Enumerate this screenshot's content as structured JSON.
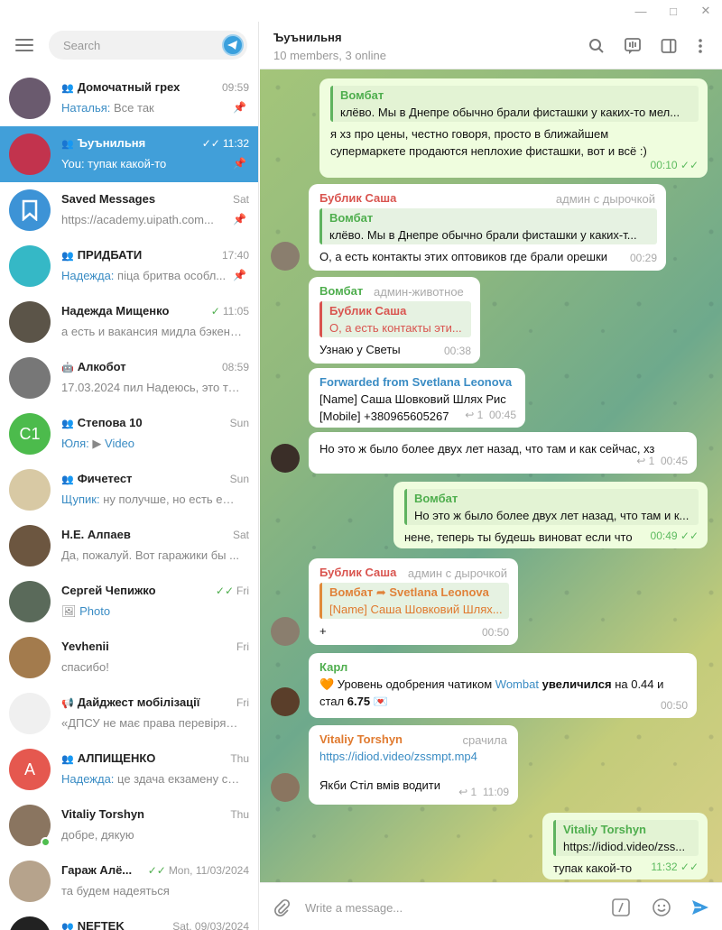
{
  "search": {
    "placeholder": "Search"
  },
  "chats": [
    {
      "name": "Домочатный грех",
      "time": "09:59",
      "sender": "Наталья: ",
      "preview": "Все так",
      "pinned": true,
      "group": true,
      "color": "#6a5a6e"
    },
    {
      "name": "Ъуъниль​ня",
      "time": "11:32",
      "sender": "You: ",
      "preview": "тупак какой-то",
      "pinned": true,
      "group": true,
      "read": true,
      "color": "#c2334d"
    },
    {
      "name": "Saved Messages",
      "time": "Sat",
      "sender": "",
      "preview": "https://academy.uipath.com...",
      "pinned": true,
      "color": "#3d93d6"
    },
    {
      "name": "ПРИДБАТИ",
      "time": "17:40",
      "sender": "Надежда: ",
      "preview": "піца бритва особл...",
      "pinned": true,
      "group": true,
      "color": "#35b8c6"
    },
    {
      "name": "Надежда Мищенко",
      "time": "11:05",
      "sender": "",
      "preview": "а есть и вакансия мидла бэкенд ...",
      "read_single": true,
      "color": "#5b5448"
    },
    {
      "name": "Алкобот",
      "time": "08:59",
      "sender": "",
      "preview": "17.03.2024 пил Надеюсь, это тог...",
      "bot": true,
      "color": "#777"
    },
    {
      "name": "Степова 10",
      "time": "Sun",
      "sender": "Юля: ",
      "preview": "Video",
      "group": true,
      "initials": "C1",
      "color": "#4cbb4c"
    },
    {
      "name": "Фичетест",
      "time": "Sun",
      "sender": "Щупик: ",
      "preview": "ну получше, но есть ещ...",
      "group": true,
      "color": "#d8c9a4"
    },
    {
      "name": "Н.Е. Алпаев",
      "time": "Sat",
      "sender": "",
      "preview": "Да, пожалуй. Вот гаражики бы ...",
      "color": "#6c5640"
    },
    {
      "name": "Сергей Чепижко",
      "time": "Fri",
      "sender": "",
      "preview": "Photo",
      "read": true,
      "color": "#5a6a5a"
    },
    {
      "name": "Yevhenii",
      "time": "Fri",
      "sender": "",
      "preview": "спасибо!",
      "color": "#a37b4d"
    },
    {
      "name": "Дайджест мобілізації",
      "time": "Fri",
      "sender": "",
      "preview": "«ДПСУ не має права перевіряти ...",
      "channel": true,
      "color": "#f0f0f0"
    },
    {
      "name": "АЛПИЩЕНКО",
      "time": "Thu",
      "sender": "Надежда: ",
      "preview": "це здача екзамену сті...",
      "group": true,
      "initials": "A",
      "color": "#e5584f"
    },
    {
      "name": "Vitaliy Torshyn",
      "time": "Thu",
      "sender": "",
      "preview": "добре, дякую",
      "online": true,
      "color": "#8a7560"
    },
    {
      "name": "Гараж Алё...",
      "time": "Mon, 11/03/2024",
      "sender": "",
      "preview": "та будем надеяться",
      "read": true,
      "color": "#b6a38c"
    },
    {
      "name": "NEFTEK",
      "time": "Sat, 09/03/2024",
      "sender": "",
      "preview": "",
      "group": true,
      "color": "#222"
    }
  ],
  "header": {
    "title": "Ъуъниль​ня",
    "subtitle": "10 members, 3 online"
  },
  "messages": {
    "m1": {
      "reply_author": "Вомбат",
      "reply_text": "клёво. Мы в Днепре обычно брали фисташки у каких-то мел...",
      "text1": "я хз про цены, честно говоря, просто в ближайшем",
      "text2": "супермаркете продаются неплохие фисташки, вот и всё :)",
      "time": "00:10"
    },
    "m2": {
      "author": "Бублик Саша",
      "role": "админ с дырочкой",
      "reply_author": "Вомбат",
      "reply_text": "клёво. Мы в Днепре обычно брали фисташки у каких-т...",
      "text": "О, а есть контакты этих оптовиков где брали орешки",
      "time": "00:29"
    },
    "m3": {
      "author": "Вомбат",
      "role": "админ-животное",
      "reply_author": "Бублик Саша",
      "reply_text": "О, а есть контакты эти...",
      "text": "Узнаю у Светы",
      "time": "00:38"
    },
    "m4": {
      "author": "Forwarded from Svetlana Leonova",
      "line1": "[Name] Саша Шовковий Шлях Рис",
      "line2": "[Mobile] +380965605267",
      "replies": "1",
      "time": "00:45"
    },
    "m5": {
      "text": "Но это ж было более двух лет назад, что там и как сейчас, хз",
      "replies": "1",
      "time": "00:45"
    },
    "m6": {
      "reply_author": "Вомбат",
      "reply_text": "Но это ж было более двух лет назад, что там и к...",
      "text": "нене, теперь ты будешь виноват если что",
      "time": "00:49"
    },
    "m7": {
      "author": "Бублик Саша",
      "role": "админ с дырочкой",
      "reply_author": "Вомбат ➦ Svetlana Leonova",
      "reply_text": "[Name] Саша Шовковий Шлях...",
      "text": "+",
      "time": "00:50"
    },
    "m8": {
      "author": "Карл",
      "pre": "🧡 Уровень одобрения чатиком ",
      "link": "Wombat",
      "bold": "увеличился",
      "mid": " на 0.44 и",
      "line2a": "стал ",
      "line2b": "6.75",
      "emoji": "💌",
      "time": "00:50"
    },
    "m9": {
      "author": "Vitaliy Torshyn",
      "role": "срачила",
      "link": "https://idiod.video/zssmpt.mp4",
      "text": "Якби Стіл вмів водити",
      "replies": "1",
      "time": "11:09"
    },
    "m10": {
      "reply_author": "Vitaliy Torshyn",
      "reply_text": "https://idiod.video/zss...",
      "text": "тупак какой-то",
      "time": "11:32"
    }
  },
  "composer": {
    "placeholder": "Write a message..."
  },
  "colors": {
    "accent": "#419fd9",
    "out_bubble": "#effdde",
    "green_author": "#4fae4e",
    "red_author": "#d9544f"
  }
}
